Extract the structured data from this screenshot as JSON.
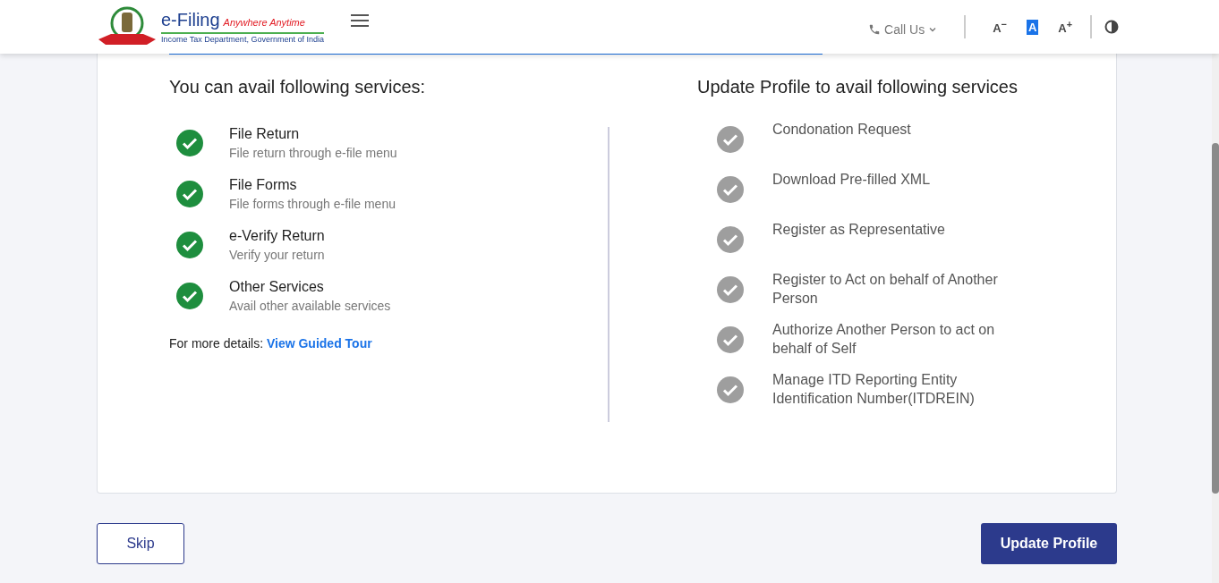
{
  "header": {
    "brand": "e-Filing",
    "tagline": "Anywhere Anytime",
    "subtitle": "Income Tax Department, Government of India",
    "call_us": "Call Us",
    "font_sizes": [
      {
        "label": "A",
        "sign": "−",
        "selected": false
      },
      {
        "label": "A",
        "selected": true
      },
      {
        "label": "A",
        "sign": "+",
        "selected": false
      }
    ]
  },
  "available": {
    "title": "You can avail following services:",
    "items": [
      {
        "title": "File Return",
        "description": "File return through e-file menu",
        "enabled": true
      },
      {
        "title": "File Forms",
        "description": "File forms through e-file menu",
        "enabled": true
      },
      {
        "title": "e-Verify Return",
        "description": "Verify your return",
        "enabled": true
      },
      {
        "title": "Other Services",
        "description": "Avail other available services",
        "enabled": true
      }
    ],
    "more_details": "For more details:",
    "guided_tour": "View Guided Tour"
  },
  "update": {
    "title": "Update Profile to avail following services",
    "items": [
      {
        "title": "Condonation Request",
        "enabled": false
      },
      {
        "title": "Download Pre-filled XML",
        "enabled": false
      },
      {
        "title": "Register as Representative",
        "enabled": false
      },
      {
        "title": "Register to Act on behalf of Another Person",
        "enabled": false
      },
      {
        "title": "Authorize Another Person to act on behalf of Self",
        "enabled": false
      },
      {
        "title": "Manage ITD Reporting Entity Identification Number(ITDREIN)",
        "enabled": false
      }
    ]
  },
  "buttons": {
    "skip": "Skip",
    "update_profile": "Update Profile"
  }
}
